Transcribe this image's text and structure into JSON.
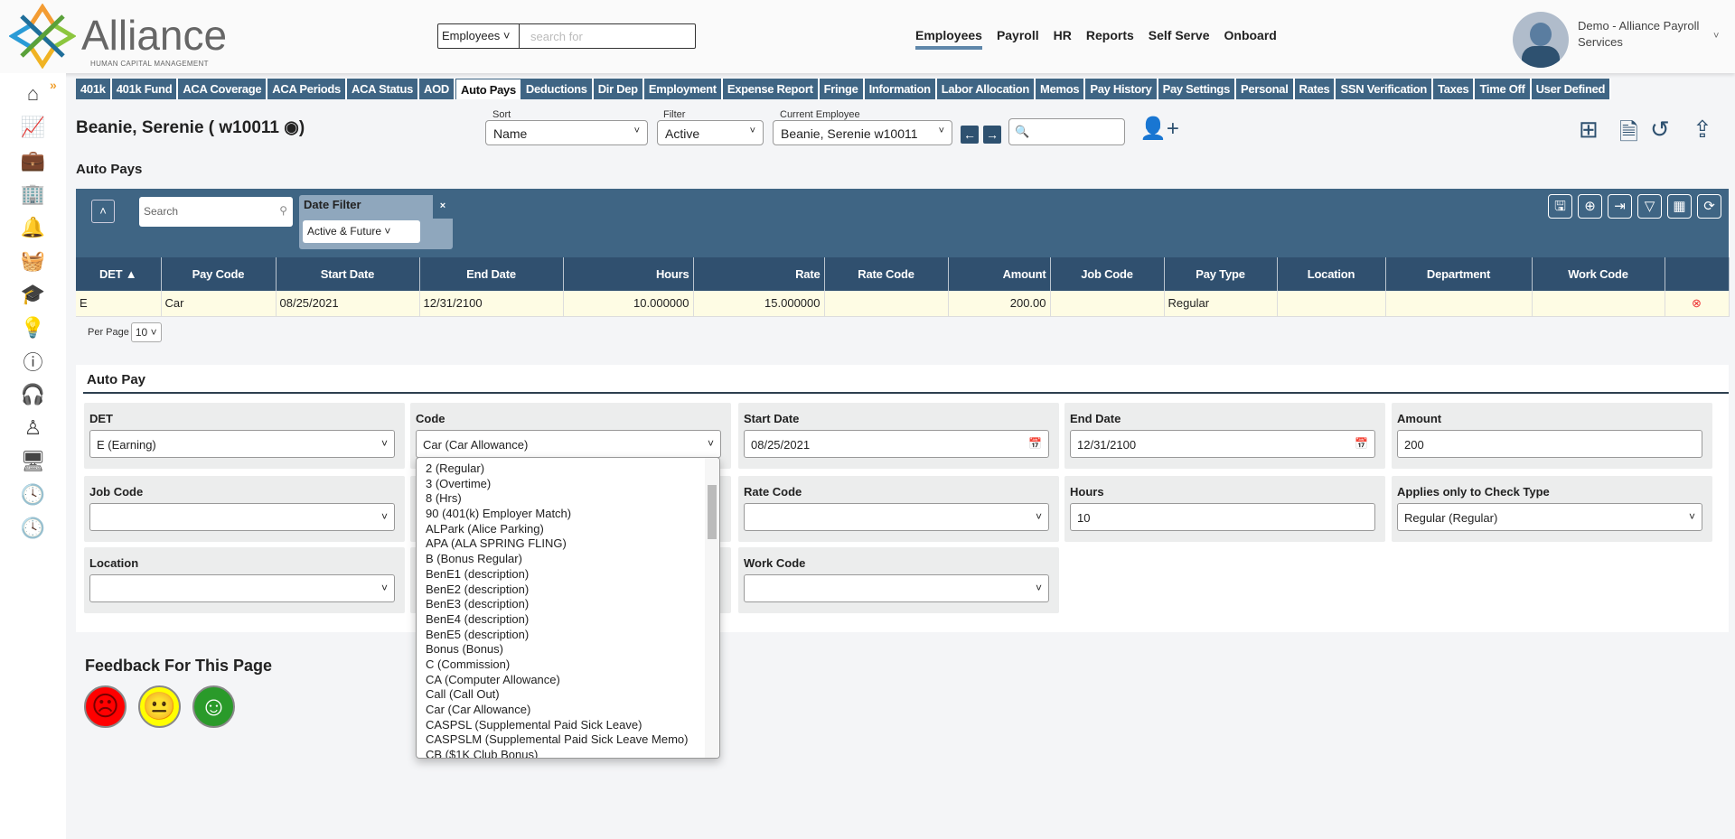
{
  "brand": {
    "name": "Alliance",
    "tagline": "HUMAN CAPITAL MANAGEMENT"
  },
  "global_search": {
    "scope": "Employees",
    "placeholder": "search for"
  },
  "nav": [
    "Employees",
    "Payroll",
    "HR",
    "Reports",
    "Self Serve",
    "Onboard"
  ],
  "user": {
    "name": "Demo - Alliance Payroll Services"
  },
  "sidebar_icons": [
    "home-icon",
    "analytics-icon",
    "briefcase-icon",
    "building-icon",
    "bell-icon",
    "basket-icon",
    "graduation-cap-icon",
    "lightbulb-icon",
    "help-icon",
    "headset-icon",
    "person-icon",
    "monitor-icon",
    "clock-icon",
    "clock-icon"
  ],
  "tabs": [
    "401k",
    "401k Fund",
    "ACA Coverage",
    "ACA Periods",
    "ACA Status",
    "AOD",
    "Auto Pays",
    "Deductions",
    "Dir Dep",
    "Employment",
    "Expense Report",
    "Fringe",
    "Information",
    "Labor Allocation",
    "Memos",
    "Pay History",
    "Pay Settings",
    "Personal",
    "Rates",
    "SSN Verification",
    "Taxes",
    "Time Off",
    "User Defined"
  ],
  "active_tab": "Auto Pays",
  "employee": {
    "title": "Beanie, Serenie ( w10011 ◉)",
    "sort_label": "Sort",
    "sort": "Name",
    "filter_label": "Filter",
    "filter": "Active",
    "current_label": "Current Employee",
    "current": "Beanie, Serenie w10011"
  },
  "section_title": "Auto Pays",
  "grid": {
    "search_placeholder": "Search",
    "date_filter_label": "Date Filter",
    "date_filter": "Active & Future",
    "columns": [
      "DET ▲",
      "Pay Code",
      "Start Date",
      "End Date",
      "Hours",
      "Rate",
      "Rate Code",
      "Amount",
      "Job Code",
      "Pay Type",
      "Location",
      "Department",
      "Work Code",
      ""
    ],
    "rows": [
      [
        "E",
        "Car",
        "08/25/2021",
        "12/31/2100",
        "10.000000",
        "15.000000",
        "",
        "200.00",
        "",
        "Regular",
        "",
        "",
        ""
      ]
    ],
    "per_page_label": "Per Page",
    "per_page": "10"
  },
  "form": {
    "title": "Auto Pay",
    "det_label": "DET",
    "det": "E (Earning)",
    "code_label": "Code",
    "code": "Car (Car Allowance)",
    "start_label": "Start Date",
    "start": "08/25/2021",
    "end_label": "End Date",
    "end": "12/31/2100",
    "amount_label": "Amount",
    "amount": "200",
    "job_label": "Job Code",
    "job": "",
    "rate_code_label": "Rate Code",
    "rate_code": "",
    "hours_label": "Hours",
    "hours": "10",
    "check_type_label": "Applies only to Check Type",
    "check_type": "Regular (Regular)",
    "location_label": "Location",
    "location": "",
    "work_code_label": "Work Code",
    "work_code": ""
  },
  "code_options": [
    "2 (Regular)",
    "3 (Overtime)",
    "8 (Hrs)",
    "90 (401(k) Employer Match)",
    "ALPark (Alice Parking)",
    "APA (ALA SPRING FLING)",
    "B (Bonus Regular)",
    "BenE1 (description)",
    "BenE2 (description)",
    "BenE3 (description)",
    "BenE4 (description)",
    "BenE5 (description)",
    "Bonus (Bonus)",
    "C (Commission)",
    "CA (Computer Allowance)",
    "Call (Call Out)",
    "Car (Car Allowance)",
    "CASPSL (Supplemental Paid Sick Leave)",
    "CASPSLM (Supplemental Paid Sick Leave Memo)",
    "CB ($1K Club Bonus)"
  ],
  "feedback": {
    "title": "Feedback For This Page"
  },
  "colors": {
    "primary": "#3f6584",
    "header": "#30506f",
    "row": "#fefce4"
  }
}
